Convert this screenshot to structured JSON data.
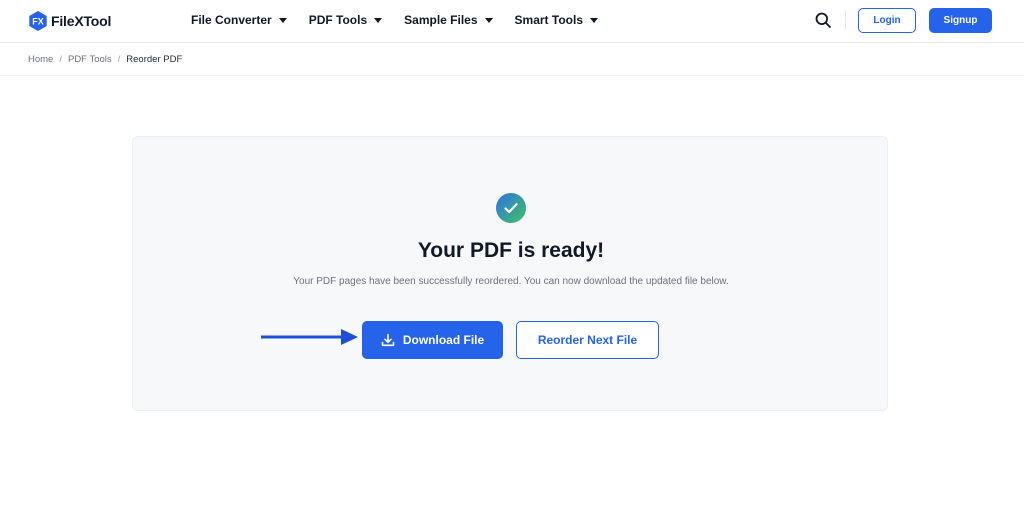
{
  "header": {
    "logo_text": "FileXTool",
    "logo_mark": "FX",
    "nav": [
      {
        "label": "File Converter"
      },
      {
        "label": "PDF Tools"
      },
      {
        "label": "Sample Files"
      },
      {
        "label": "Smart Tools"
      }
    ],
    "login_label": "Login",
    "signup_label": "Signup"
  },
  "breadcrumb": {
    "items": [
      "Home",
      "PDF Tools",
      "Reorder PDF"
    ],
    "separator": "/"
  },
  "result": {
    "title": "Your PDF is ready!",
    "message": "Your PDF pages have been successfully reordered. You can now download the updated file below.",
    "download_label": "Download File",
    "next_label": "Reorder Next File"
  },
  "colors": {
    "accent": "#2563eb",
    "check_gradient_start": "#2f6fed",
    "check_gradient_end": "#3ec55a"
  },
  "icons": {
    "search": "search-icon",
    "caret": "chevron-down-icon",
    "success": "check-circle-icon",
    "download": "download-icon",
    "arrow": "arrow-right-icon"
  }
}
